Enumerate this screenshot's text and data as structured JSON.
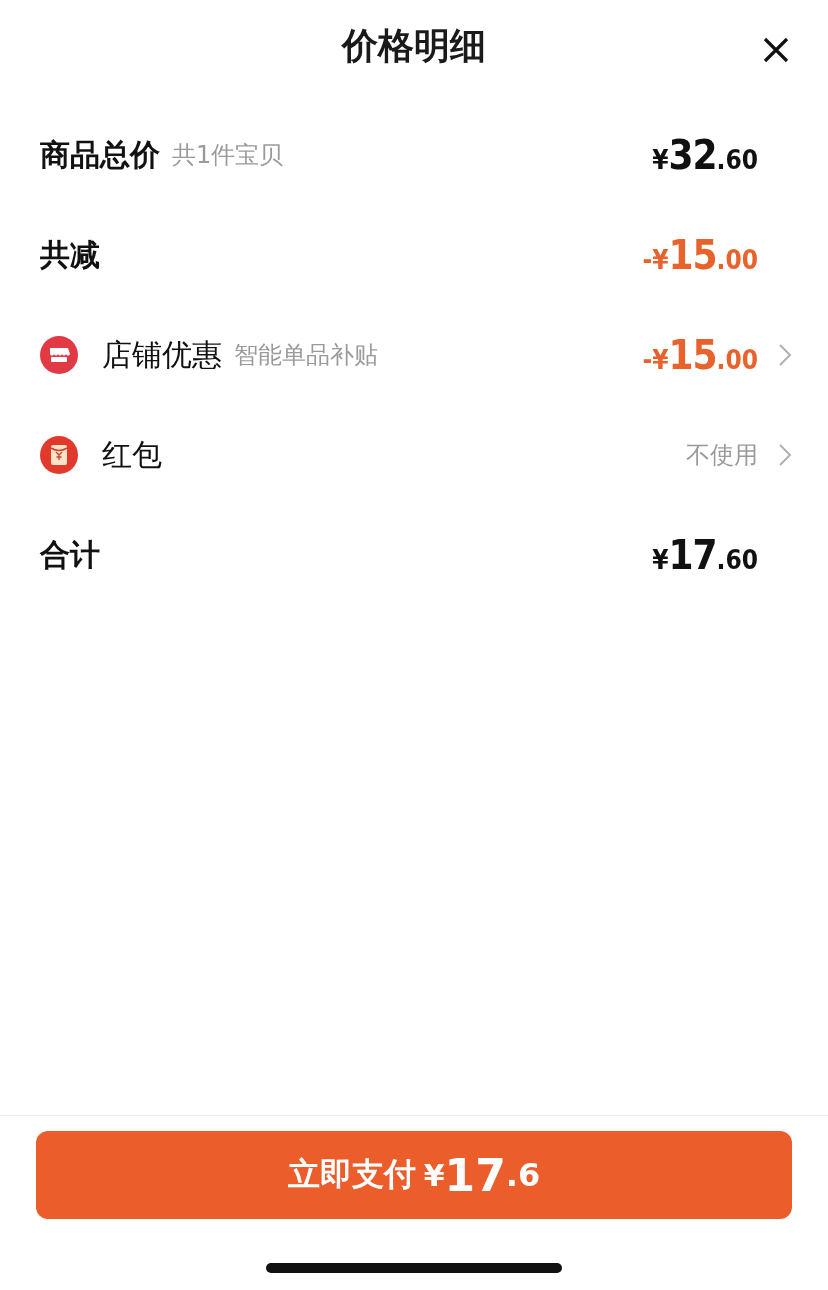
{
  "header": {
    "title": "价格明细"
  },
  "rows": [
    {
      "kind": "plain",
      "label": "商品总价",
      "note": "共1件宝贝",
      "price": {
        "prefix": "¥",
        "whole": "32",
        "fraction": ".60"
      },
      "highlight": false
    },
    {
      "kind": "plain",
      "label": "共减",
      "price": {
        "prefix": "-¥",
        "whole": "15",
        "fraction": ".00"
      },
      "highlight": true
    },
    {
      "kind": "store",
      "label": "店铺优惠",
      "note": "智能单品补贴",
      "price": {
        "prefix": "-¥",
        "whole": "15",
        "fraction": ".00"
      },
      "highlight": true,
      "chevron": true
    },
    {
      "kind": "envelope",
      "label": "红包",
      "value": "不使用",
      "chevron": true
    },
    {
      "kind": "plain",
      "label": "合计",
      "price": {
        "prefix": "¥",
        "whole": "17",
        "fraction": ".60"
      },
      "highlight": false
    }
  ],
  "pay_button": {
    "label": "立即支付",
    "prefix": "¥",
    "whole": "17",
    "fraction": ".6"
  }
}
